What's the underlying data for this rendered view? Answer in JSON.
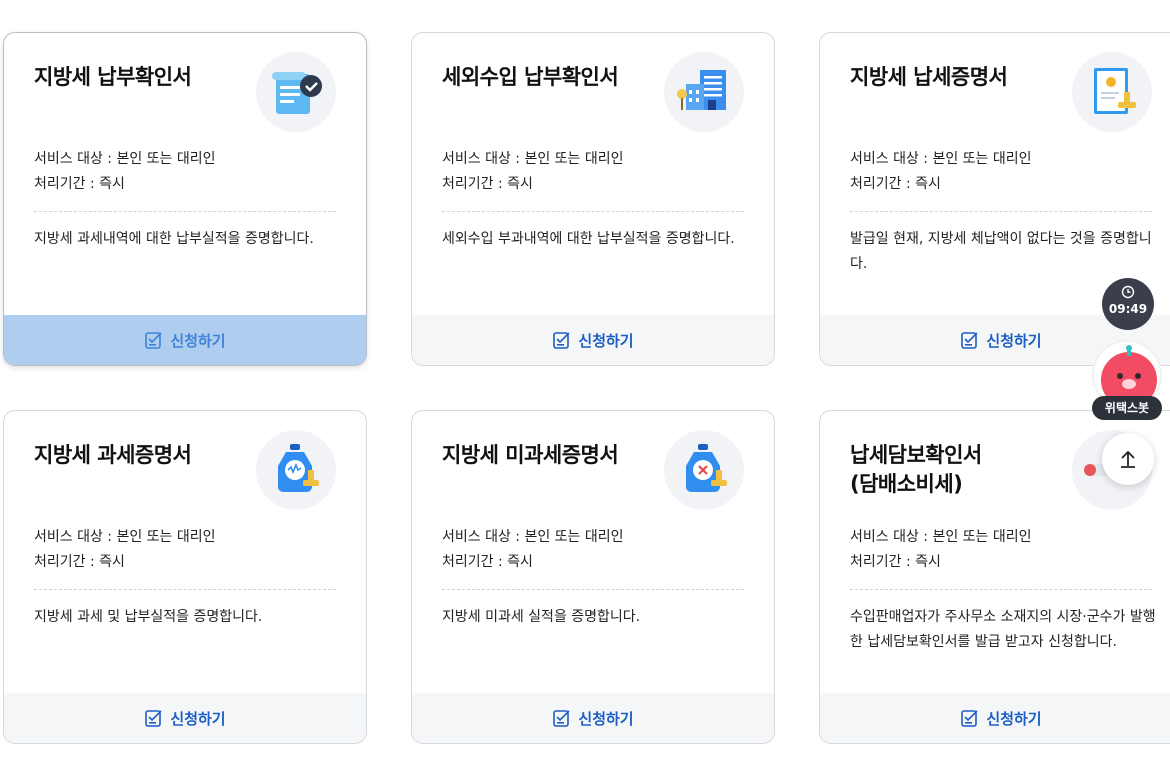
{
  "cards": [
    {
      "title": "지방세 납부확인서",
      "icon": "scroll-check-icon",
      "target": "서비스 대상 : 본인 또는 대리인",
      "period": "처리기간 : 즉시",
      "description": "지방세 과세내역에 대한 납부실적을 증명합니다.",
      "apply_label": "신청하기"
    },
    {
      "title": "세외수입 납부확인서",
      "icon": "building-document-icon",
      "target": "서비스 대상 : 본인 또는 대리인",
      "period": "처리기간 : 즉시",
      "description": "세외수입 부과내역에 대한 납부실적을 증명합니다.",
      "apply_label": "신청하기"
    },
    {
      "title": "지방세 납세증명서",
      "icon": "certificate-icon",
      "target": "서비스 대상 : 본인 또는 대리인",
      "period": "처리기간 : 즉시",
      "description": "발급일 현재, 지방세 체납액이 없다는 것을 증명합니다.",
      "apply_label": "신청하기"
    },
    {
      "title": "지방세 과세증명서",
      "icon": "money-bag-stamp-icon",
      "target": "서비스 대상 : 본인 또는 대리인",
      "period": "처리기간 : 즉시",
      "description": "지방세 과세 및 납부실적을 증명합니다.",
      "apply_label": "신청하기"
    },
    {
      "title": "지방세 미과세증명서",
      "icon": "money-bag-x-icon",
      "target": "서비스 대상 : 본인 또는 대리인",
      "period": "처리기간 : 즉시",
      "description": "지방세 미과세 실적을 증명합니다.",
      "apply_label": "신청하기"
    },
    {
      "title": "납세담보확인서\n(담배소비세)",
      "icon": "cigarette-icon",
      "target": "서비스 대상 : 본인 또는 대리인",
      "period": "처리기간 : 즉시",
      "description": "수입판매업자가 주사무소 소재지의 시장·군수가 발행한 납세담보확인서를 발급 받고자 신청합니다.",
      "apply_label": "신청하기"
    }
  ],
  "widgets": {
    "timer_value": "09:49",
    "bot_label": "위택스봇",
    "timer_icon": "clock-icon",
    "top_icon": "arrow-up-icon"
  },
  "colors": {
    "accent": "#1d5fc4",
    "hover_bar": "#aecdef",
    "bar": "#f5f6f8"
  }
}
